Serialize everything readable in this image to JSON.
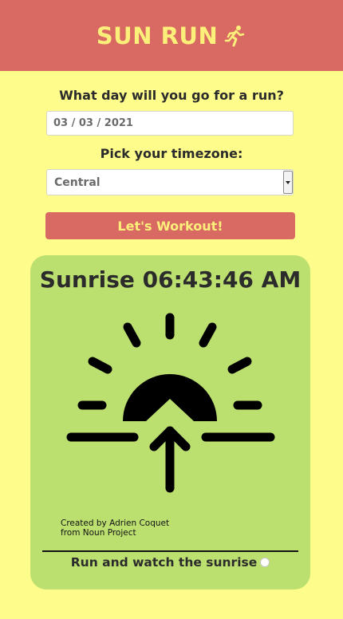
{
  "header": {
    "title": "SUN RUN",
    "icon": "runner-icon",
    "background": "#d96a63",
    "title_color": "#fcef7a"
  },
  "form": {
    "day_label": "What day will you go for a run?",
    "date_value": "03 / 03 / 2021",
    "timezone_label": "Pick your timezone:",
    "timezone_value": "Central",
    "submit_label": "Let's Workout!"
  },
  "result": {
    "title": "Sunrise 06:43:46 AM",
    "icon": "sunrise-icon",
    "credit_line1": "Created by Adrien Coquet",
    "credit_line2": "from Noun Project",
    "footer_text": "Run and watch the sunrise",
    "card_color": "#bce070"
  },
  "colors": {
    "page_background": "#fefc8a",
    "accent": "#d96a63"
  }
}
